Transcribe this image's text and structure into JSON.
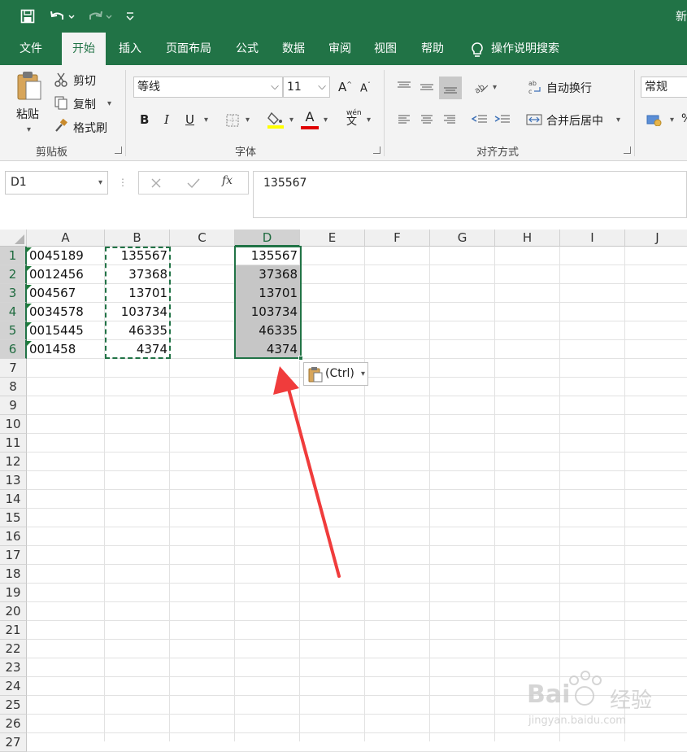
{
  "titlebar": {
    "title": "新",
    "accent": "#217346"
  },
  "tabs": [
    {
      "label": "文件"
    },
    {
      "label": "开始"
    },
    {
      "label": "插入"
    },
    {
      "label": "页面布局"
    },
    {
      "label": "公式"
    },
    {
      "label": "数据"
    },
    {
      "label": "审阅"
    },
    {
      "label": "视图"
    },
    {
      "label": "帮助"
    },
    {
      "label": "操作说明搜索"
    }
  ],
  "ribbon": {
    "clipboard": {
      "paste": "粘贴",
      "cut": "剪切",
      "copy": "复制",
      "format_painter": "格式刷",
      "label": "剪贴板"
    },
    "font": {
      "font_name": "等线",
      "font_size": "11",
      "bold": "B",
      "italic": "I",
      "underline": "U",
      "font_color": "A",
      "grow": "A",
      "shrink": "A",
      "phonetic_top": "wén",
      "phonetic_bottom": "文",
      "label": "字体"
    },
    "alignment": {
      "wrap_text": "自动换行",
      "merge_center": "合并后居中",
      "label": "对齐方式"
    },
    "number": {
      "format": "常规"
    }
  },
  "formula_bar": {
    "name_box": "D1",
    "fx": "fx",
    "value": "135567"
  },
  "grid": {
    "columns": [
      "A",
      "B",
      "C",
      "D",
      "E",
      "F",
      "G",
      "H",
      "I",
      "J"
    ],
    "selected_column": "D",
    "rows": [
      "1",
      "2",
      "3",
      "4",
      "5",
      "6",
      "7",
      "8",
      "9",
      "10",
      "11",
      "12",
      "13",
      "14",
      "15",
      "16",
      "17",
      "18",
      "19",
      "20",
      "21",
      "22",
      "23",
      "24",
      "25",
      "26",
      "27"
    ],
    "column_a": [
      "0045189",
      "0012456",
      "004567",
      "0034578",
      "0015445",
      "001458"
    ],
    "column_b": [
      "135567",
      "37368",
      "13701",
      "103734",
      "46335",
      "4374"
    ],
    "column_d": [
      "135567",
      "37368",
      "13701",
      "103734",
      "46335",
      "4374"
    ]
  },
  "paste_options": {
    "label": "(Ctrl)"
  },
  "watermark": {
    "brand": "Bai",
    "suffix": "经验",
    "url": "jingyan.baidu.com"
  },
  "colors": {
    "excel_green": "#217346",
    "arrow": "#f03c3c",
    "selection_fill": "#c6c6c6"
  }
}
